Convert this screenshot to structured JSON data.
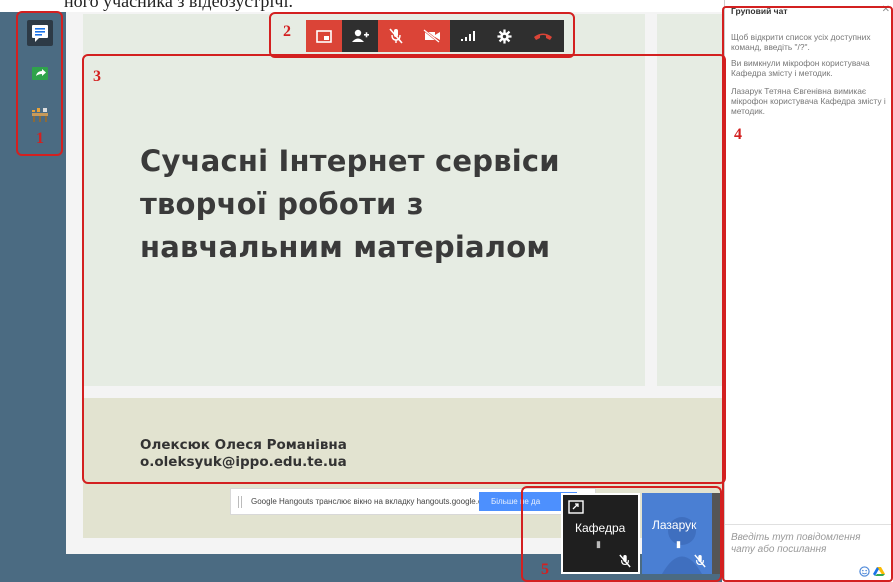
{
  "caption_fragment": "ного учасника з відеозустрічі.",
  "annotations": {
    "n1": "1",
    "n2": "2",
    "n3": "3",
    "n4": "4",
    "n5": "5"
  },
  "sidebar": {
    "items": [
      {
        "name": "chat-icon"
      },
      {
        "name": "screenshare-icon"
      },
      {
        "name": "effects-icon"
      }
    ]
  },
  "toolbar": {
    "buttons": [
      {
        "name": "pip-toggle-icon",
        "active": true
      },
      {
        "name": "add-person-icon",
        "active": false
      },
      {
        "name": "mic-off-icon",
        "active": true
      },
      {
        "name": "camera-off-icon",
        "active": true
      },
      {
        "name": "signal-icon",
        "active": false
      },
      {
        "name": "settings-gear-icon",
        "active": false
      },
      {
        "name": "hang-up-icon",
        "active": false
      }
    ]
  },
  "slide": {
    "title_lines": [
      "Сучасні Інтернет сервіси",
      "творчої роботи з",
      "навчальним матеріалом"
    ],
    "author_name": "Олексюк Олеся Романівна",
    "author_email": "o.oleksyuk@ippo.edu.te.ua"
  },
  "notification": {
    "text": "Google Hangouts транслює вікно на вкладку hangouts.google.com.",
    "button": "Більше не да"
  },
  "chat": {
    "title": "Груповий чат",
    "close": "✕",
    "messages": [
      "Щоб відкрити список усіх доступних команд, введіть \"/?\".",
      "Ви вимкнули мікрофон користувача Кафедра змісту і методик.",
      "Лазарук Тетяна Євгенівна вимикає мікрофон користувача Кафедра змісту і методик."
    ],
    "input_placeholder": "Введіть тут повідомлення чату або посилання"
  },
  "participants": [
    {
      "name": "Кафедра",
      "muted": true,
      "selected": true
    },
    {
      "name": "Лазарук",
      "muted": true,
      "selected": false
    }
  ],
  "colors": {
    "accent_red": "#db4437",
    "annotation_red": "#d32020",
    "stage": "#4b6b82",
    "toolbar": "#2f2f2f"
  }
}
